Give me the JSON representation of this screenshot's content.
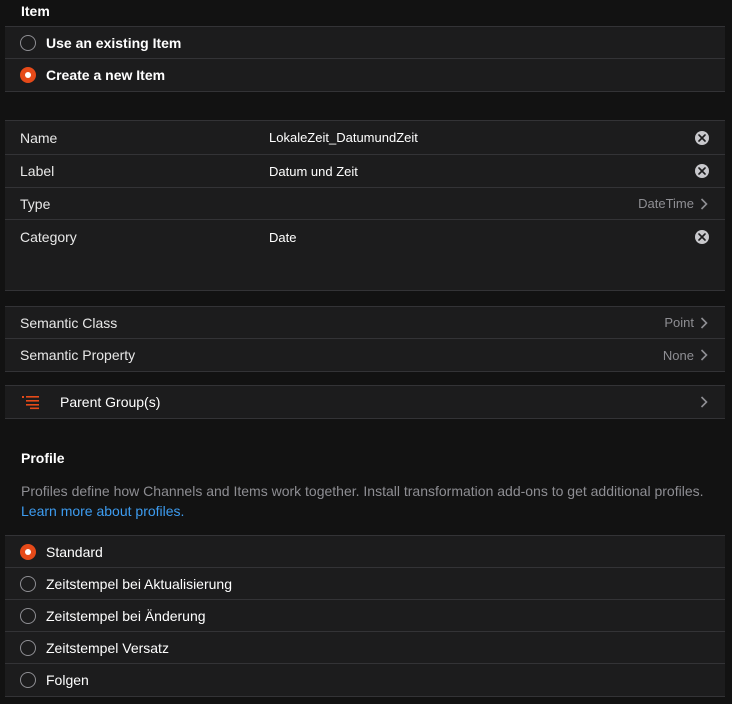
{
  "item_section": {
    "title": "Item",
    "options": [
      {
        "label": "Use an existing Item",
        "checked": false
      },
      {
        "label": "Create a new Item",
        "checked": true
      }
    ]
  },
  "fields": {
    "name": {
      "label": "Name",
      "value": "LokaleZeit_DatumundZeit"
    },
    "label": {
      "label": "Label",
      "value": "Datum und Zeit"
    },
    "type": {
      "label": "Type",
      "value": "DateTime"
    },
    "category": {
      "label": "Category",
      "value": "Date"
    }
  },
  "semantics": {
    "class": {
      "label": "Semantic Class",
      "value": "Point"
    },
    "property": {
      "label": "Semantic Property",
      "value": "None"
    }
  },
  "parent_groups": {
    "label": "Parent Group(s)",
    "icon": "list-icon"
  },
  "profile": {
    "title": "Profile",
    "description": "Profiles define how Channels and Items work together. Install transformation add-ons to get additional profiles.",
    "link": "Learn more about profiles.",
    "options": [
      {
        "label": "Standard",
        "checked": true
      },
      {
        "label": "Zeitstempel bei Aktualisierung",
        "checked": false
      },
      {
        "label": "Zeitstempel bei Änderung",
        "checked": false
      },
      {
        "label": "Zeitstempel Versatz",
        "checked": false
      },
      {
        "label": "Folgen",
        "checked": false
      }
    ]
  },
  "colors": {
    "background": "#121212",
    "list_background": "#1c1c1d",
    "accent": "#e64a19",
    "link": "#3d9cf0",
    "muted_text": "#8e8e93"
  }
}
